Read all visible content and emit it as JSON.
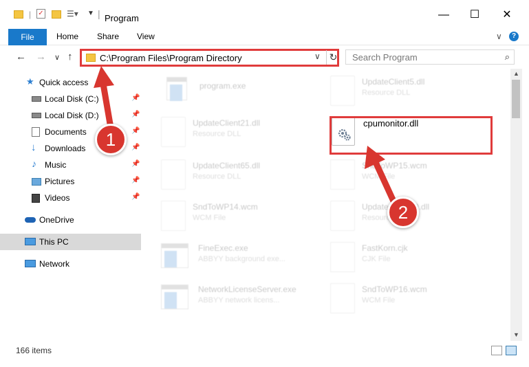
{
  "window": {
    "title": "Program",
    "controls": {
      "minimize": "—",
      "maximize": "☐",
      "close": "✕"
    }
  },
  "ribbon": {
    "tabs": [
      "File",
      "Home",
      "Share",
      "View"
    ],
    "expand": "∨",
    "help": "?"
  },
  "address": {
    "path": "C:\\Program Files\\Program Directory",
    "dropdown": "∨",
    "refresh": "↻"
  },
  "search": {
    "placeholder": "Search Program",
    "icon": "⌕"
  },
  "nav": {
    "back": "←",
    "forward": "→",
    "recent": "∨",
    "up": "↑"
  },
  "sidebar": {
    "items": [
      {
        "label": "Quick access",
        "icon": "star-icon",
        "pinned": false
      },
      {
        "label": "Local Disk (C:)",
        "icon": "drive-icon",
        "pinned": true
      },
      {
        "label": "Local Disk (D:)",
        "icon": "drive-icon",
        "pinned": true
      },
      {
        "label": "Documents",
        "icon": "documents-icon",
        "pinned": true
      },
      {
        "label": "Downloads",
        "icon": "download-icon",
        "pinned": true
      },
      {
        "label": "Music",
        "icon": "music-icon",
        "pinned": true
      },
      {
        "label": "Pictures",
        "icon": "pictures-icon",
        "pinned": true
      },
      {
        "label": "Videos",
        "icon": "videos-icon",
        "pinned": true
      },
      {
        "label": "OneDrive",
        "icon": "cloud-icon",
        "pinned": false
      },
      {
        "label": "This PC",
        "icon": "computer-icon",
        "pinned": false,
        "selected": true
      },
      {
        "label": "Network",
        "icon": "network-icon",
        "pinned": false
      }
    ]
  },
  "files": [
    {
      "name": "program.exe",
      "type": "",
      "icon": "exe-icon"
    },
    {
      "name": "UpdateClient5.dll",
      "type": "Resource DLL",
      "icon": "dll-icon"
    },
    {
      "name": "UpdateClient21.dll",
      "type": "Resource DLL",
      "icon": "dll-icon"
    },
    {
      "name": "cpumonitor.dll",
      "type": "",
      "icon": "dll-icon",
      "highlighted": true
    },
    {
      "name": "UpdateClient65.dll",
      "type": "Resource DLL",
      "icon": "dll-icon"
    },
    {
      "name": "SndToWP15.wcm",
      "type": "WCM File",
      "icon": "file-icon"
    },
    {
      "name": "SndToWP14.wcm",
      "type": "WCM File",
      "icon": "file-icon"
    },
    {
      "name": "UpdateClient19.dll",
      "type": "Resource DLL",
      "icon": "dll-icon"
    },
    {
      "name": "FineExec.exe",
      "type": "ABBYY background exe...",
      "icon": "app-icon"
    },
    {
      "name": "FastKorn.cjk",
      "type": "CJK File",
      "icon": "file-icon"
    },
    {
      "name": "NetworkLicenseServer.exe",
      "type": "ABBYY network licens...",
      "icon": "app-icon"
    },
    {
      "name": "SndToWP16.wcm",
      "type": "WCM File",
      "icon": "file-icon"
    }
  ],
  "status": {
    "item_count": "166 items"
  },
  "annotations": {
    "step1": "1",
    "step2": "2"
  },
  "colors": {
    "accent": "#1979ca",
    "highlight": "#e03b3b",
    "badge": "#d8362f"
  }
}
